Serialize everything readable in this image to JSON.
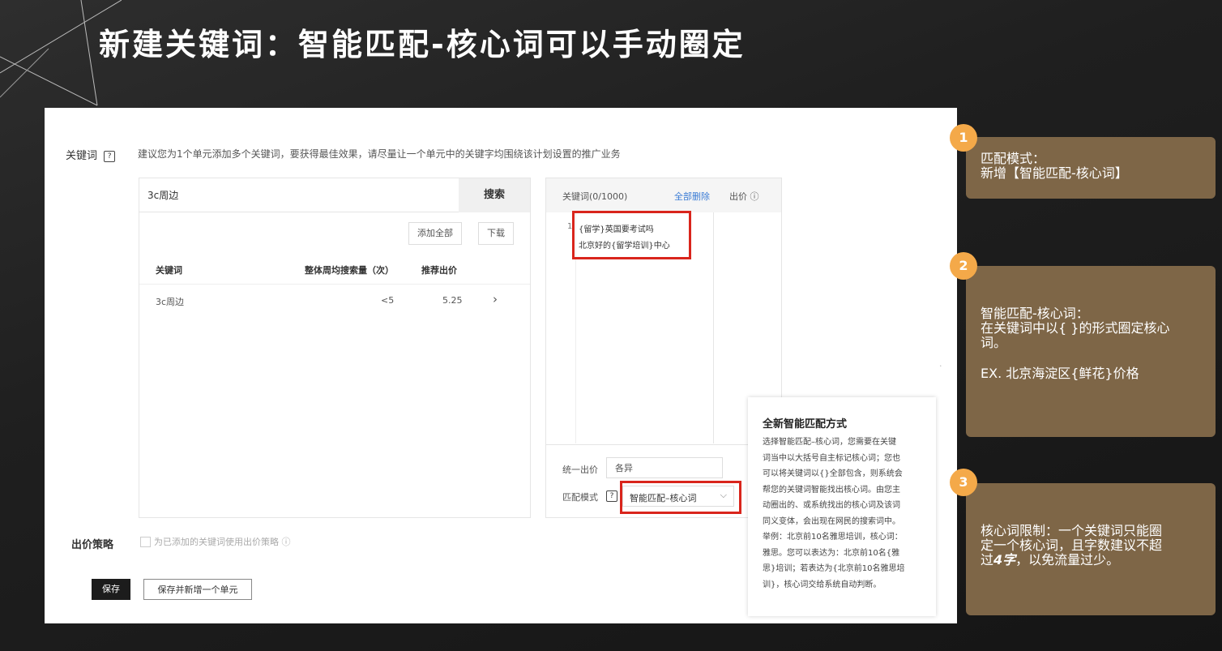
{
  "title": "新建关键词：智能匹配-核心词可以手动圈定",
  "form": {
    "keyword_label": "关键词",
    "hint": "建议您为1个单元添加多个关键词，要获得最佳效果，请尽量让一个单元中的关键字均围绕该计划设置的推广业务",
    "search": {
      "value": "3c周边",
      "button": "搜索"
    },
    "add_all": "添加全部",
    "download": "下载",
    "table": {
      "headers": [
        "关键词",
        "整体周均搜索量（次）",
        "推荐出价"
      ],
      "rows": [
        {
          "keyword": "3c周边",
          "volume": "<5",
          "bid": "5.25",
          "action": "›"
        }
      ]
    },
    "selected": {
      "header_label": "关键词(0/1000)",
      "delete_all": "全部删除",
      "bid_col": "出价 ⓘ",
      "row_number": "1",
      "items": [
        "{留学}英国要考试吗",
        "北京好的{留学培训}中心"
      ]
    },
    "unified_bid": {
      "label": "统一出价",
      "placeholder": "各异"
    },
    "match_mode": {
      "label": "匹配模式",
      "value": "智能匹配–核心词"
    },
    "bid_strategy": {
      "label": "出价策略",
      "checkbox_text": "为已添加的关键词使用出价策略 ⓘ"
    },
    "save": "保存",
    "save_and_new": "保存并新增一个单元"
  },
  "popover": {
    "title": "全新智能匹配方式",
    "lines": [
      "选择智能匹配–核心词，您需要在关键",
      "词当中以大括号自主标记核心词；您也",
      "可以将关键词以{}全部包含，则系统会",
      "帮您的关键词智能找出核心词。由您主",
      "动圈出的、或系统找出的核心词及该词",
      "同义变体，会出现在网民的搜索词中。",
      "举例：北京前10名雅思培训，核心词：",
      "雅思。您可以表达为：北京前10名{雅",
      "思}培训；若表达为{北京前10名雅思培",
      "训}，核心词交给系统自动判断。"
    ]
  },
  "annotations": [
    {
      "number": "1",
      "lines": [
        "匹配模式：",
        "新增【智能匹配-核心词】"
      ]
    },
    {
      "number": "2",
      "lines": [
        "智能匹配-核心词：",
        "在关键词中以{ }的形式圈定核心",
        "词。",
        "",
        "EX. 北京海淀区{鲜花}价格"
      ]
    },
    {
      "number": "3",
      "lines": [
        "核心词限制：一个关键词只能圈",
        "定一个核心词，且字数建议不超"
      ],
      "last_prefix": "过",
      "last_emph": "4字",
      "last_suffix": "，以免流量过少。"
    }
  ],
  "colors": {
    "annotation_card": "#7e6647",
    "annotation_badge": "#f4a949",
    "highlight_box": "#d9251c",
    "link_blue": "#3a7bd5"
  }
}
